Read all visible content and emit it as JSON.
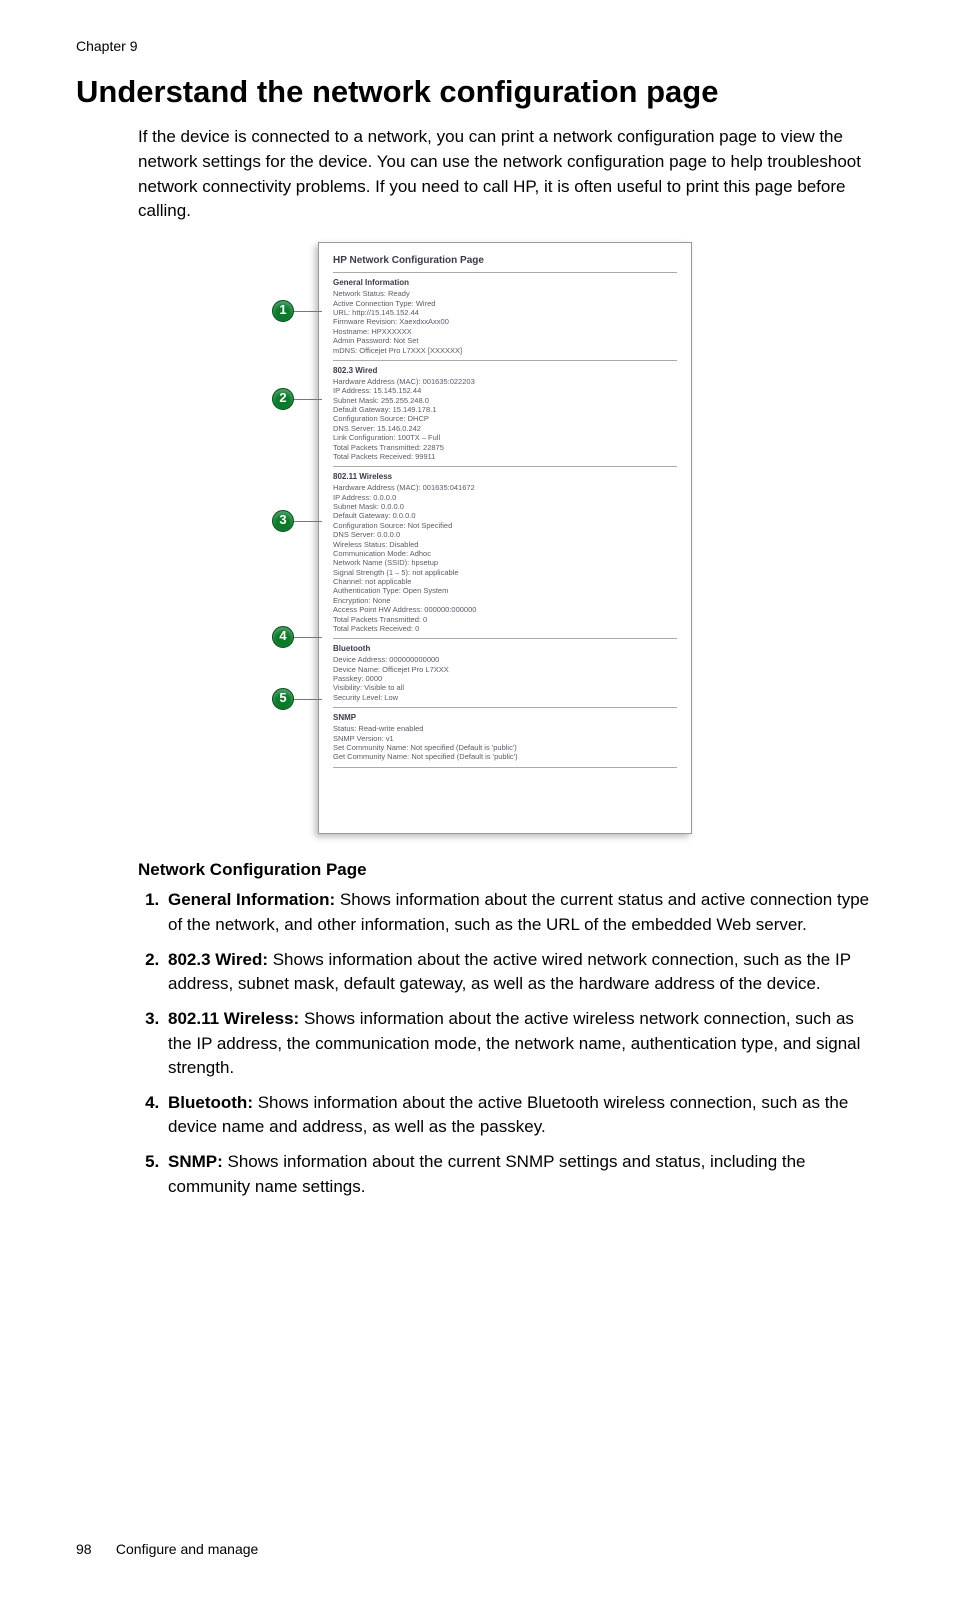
{
  "chapter": "Chapter 9",
  "title": "Understand the network configuration page",
  "intro": "If the device is connected to a network, you can print a network configuration page to view the network settings for the device. You can use the network configuration page to help troubleshoot network connectivity problems. If you need to call HP, it is often useful to print this page before calling.",
  "diagram": {
    "title": "HP Network Configuration Page",
    "sections": [
      {
        "num": "1",
        "heading": "General Information",
        "lines": [
          "Network Status: Ready",
          "Active Connection Type: Wired",
          "URL: http://15.145.152.44",
          "Firmware Revision: XaexdxxAxx00",
          "Hostname: HPXXXXXX",
          "Admin Password: Not Set",
          "mDNS: Officejet Pro L7XXX [XXXXXX]"
        ]
      },
      {
        "num": "2",
        "heading": "802.3 Wired",
        "lines": [
          "Hardware Address (MAC): 001635:022203",
          "IP Address: 15.145.152.44",
          "Subnet Mask: 255.255.248.0",
          "Default Gateway: 15.149.178.1",
          "Configuration Source: DHCP",
          "DNS Server: 15.146.0.242",
          "Link Configuration: 100TX – Full",
          "Total Packets Transmitted: 22875",
          "Total Packets Received: 99911"
        ]
      },
      {
        "num": "3",
        "heading": "802.11 Wireless",
        "lines": [
          "Hardware Address (MAC): 001635:041672",
          "IP Address: 0.0.0.0",
          "Subnet Mask: 0.0.0.0",
          "Default Gateway: 0.0.0.0",
          "Configuration Source: Not Specified",
          "DNS Server: 0.0.0.0",
          "Wireless Status: Disabled",
          "Communication Mode: Adhoc",
          "Network Name (SSID): hpsetup",
          "Signal Strength (1 – 5): not applicable",
          "Channel: not applicable",
          "Authentication Type: Open System",
          "Encryption: None",
          "Access Point HW Address: 000000:000000",
          "Total Packets Transmitted: 0",
          "Total Packets Received: 0"
        ]
      },
      {
        "num": "4",
        "heading": "Bluetooth",
        "lines": [
          "Device Address: 000000000000",
          "Device Name: Officejet Pro L7XXX",
          "Passkey: 0000",
          "Visibility: Visible to all",
          "Security Level: Low"
        ]
      },
      {
        "num": "5",
        "heading": "SNMP",
        "lines": [
          "Status: Read-write enabled",
          "SNMP Version: v1",
          "Set Community Name: Not specified (Default is 'public')",
          "Get Community Name: Not specified (Default is 'public')"
        ]
      }
    ]
  },
  "subheading": "Network Configuration Page",
  "list": [
    {
      "num": "1.",
      "label": "General Information:",
      "text": " Shows information about the current status and active connection type of the network, and other information, such as the URL of the embedded Web server."
    },
    {
      "num": "2.",
      "label": "802.3 Wired:",
      "text": " Shows information about the active wired network connection, such as the IP address, subnet mask, default gateway, as well as the hardware address of the device."
    },
    {
      "num": "3.",
      "label": "802.11 Wireless:",
      "text": " Shows information about the active wireless network connection, such as the IP address, the communication mode, the network name, authentication type, and signal strength."
    },
    {
      "num": "4.",
      "label": "Bluetooth:",
      "text": " Shows information about the active Bluetooth wireless connection, such as the device name and address, as well as the passkey."
    },
    {
      "num": "5.",
      "label": "SNMP:",
      "text": " Shows information about the current SNMP settings and status, including the community name settings."
    }
  ],
  "footer": {
    "page": "98",
    "section": "Configure and manage"
  }
}
